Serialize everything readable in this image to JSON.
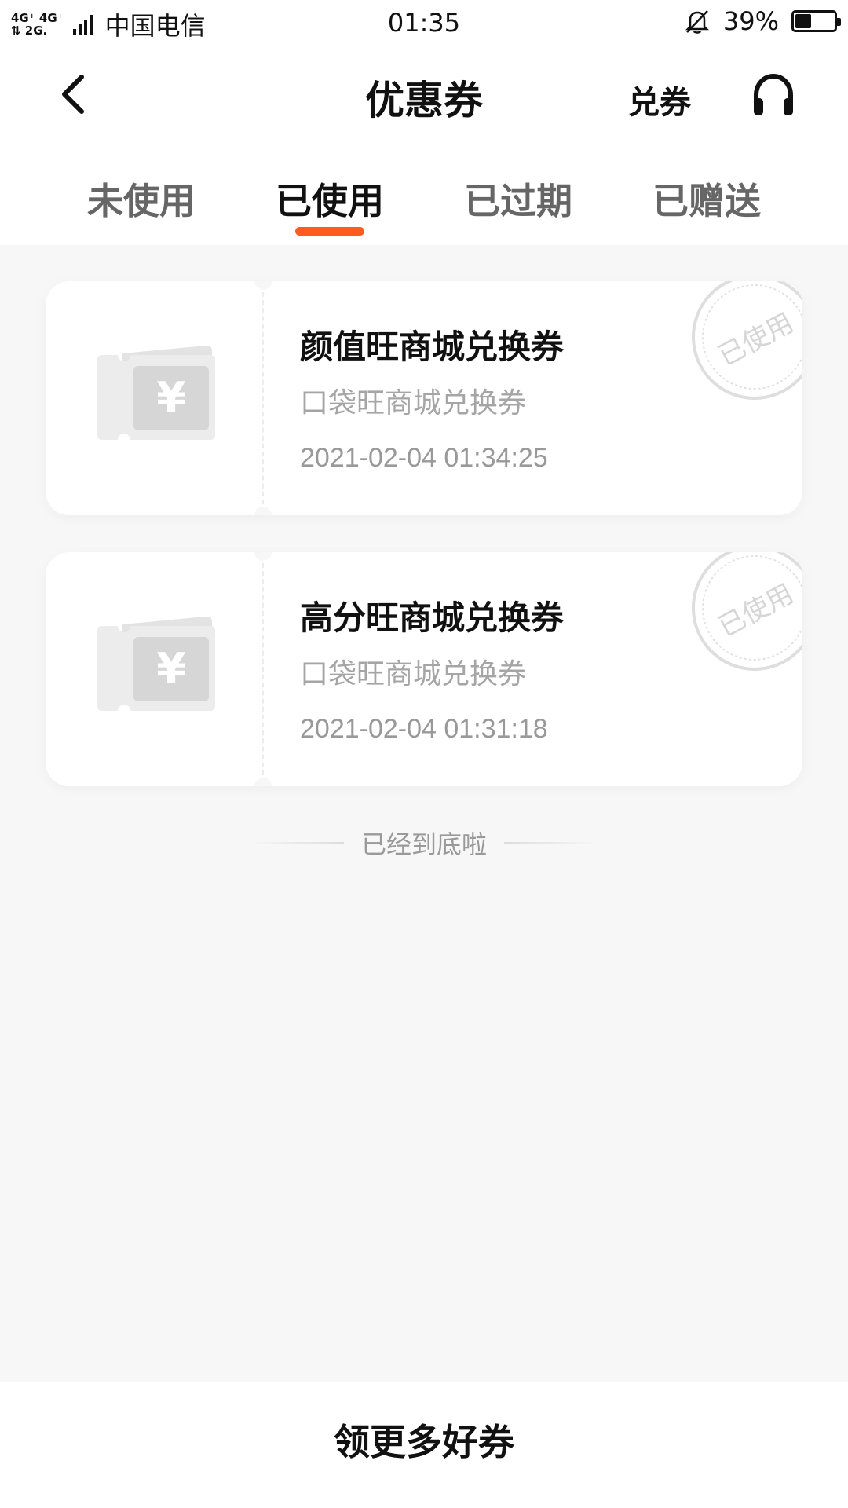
{
  "status_bar": {
    "network_top": "4G⁺ 4G⁺",
    "network_bottom": "⇅ 2G.",
    "carrier": "中国电信",
    "time": "01:35",
    "battery": "39%",
    "battery_level": 0.39
  },
  "header": {
    "title": "优惠券",
    "redeem_label": "兑券"
  },
  "tabs": [
    {
      "label": "未使用",
      "active": false
    },
    {
      "label": "已使用",
      "active": true
    },
    {
      "label": "已过期",
      "active": false
    },
    {
      "label": "已赠送",
      "active": false
    }
  ],
  "coupons": [
    {
      "title": "颜值旺商城兑换券",
      "subtitle": "口袋旺商城兑换券",
      "time": "2021-02-04 01:34:25",
      "stamp": "已使用"
    },
    {
      "title": "高分旺商城兑换券",
      "subtitle": "口袋旺商城兑换券",
      "time": "2021-02-04 01:31:18",
      "stamp": "已使用"
    }
  ],
  "list_end_text": "已经到底啦",
  "bottom": {
    "button_label": "领更多好券"
  },
  "colors": {
    "accent": "#ff5a1f",
    "background": "#f7f7f7",
    "card": "#ffffff",
    "muted_text": "#a5a5a5"
  }
}
